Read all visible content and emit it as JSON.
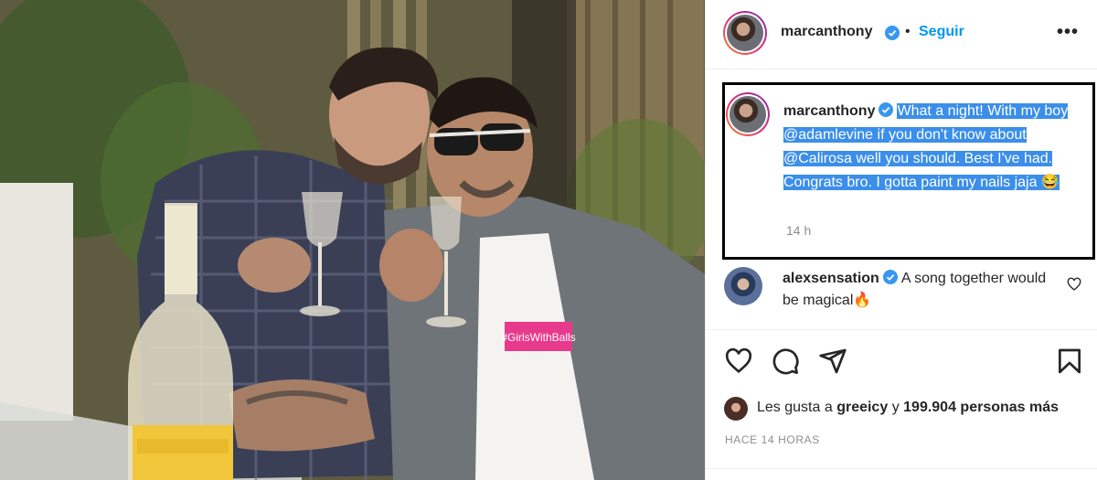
{
  "post": {
    "username": "marcanthony",
    "dot": "•",
    "follow_label": "Seguir",
    "more_label": "•••",
    "caption": "What a night! With my boy @adamlevine if you don't know about @Calirosa well you should. Best I've had. Congrats bro. I gotta paint my nails jaja 😂",
    "time": "14 h",
    "photo": {
      "shirt_text": "#GirlsWithBalls"
    }
  },
  "comment": {
    "username": "alexsensation",
    "text": "A song together would be magical🔥"
  },
  "actions": {
    "like_icon": "heart-icon",
    "comment_icon": "comment-icon",
    "share_icon": "share-icon",
    "save_icon": "bookmark-icon"
  },
  "likes": {
    "prefix": "Les gusta a",
    "user": "greeicy",
    "joiner": "y",
    "count": "199.904 personas más"
  },
  "timestamp": "HACE 14 HORAS",
  "colors": {
    "accent": "#0095f6",
    "verified": "#3897f0",
    "selection": "#3b8eea",
    "caption_border": "#000000"
  }
}
